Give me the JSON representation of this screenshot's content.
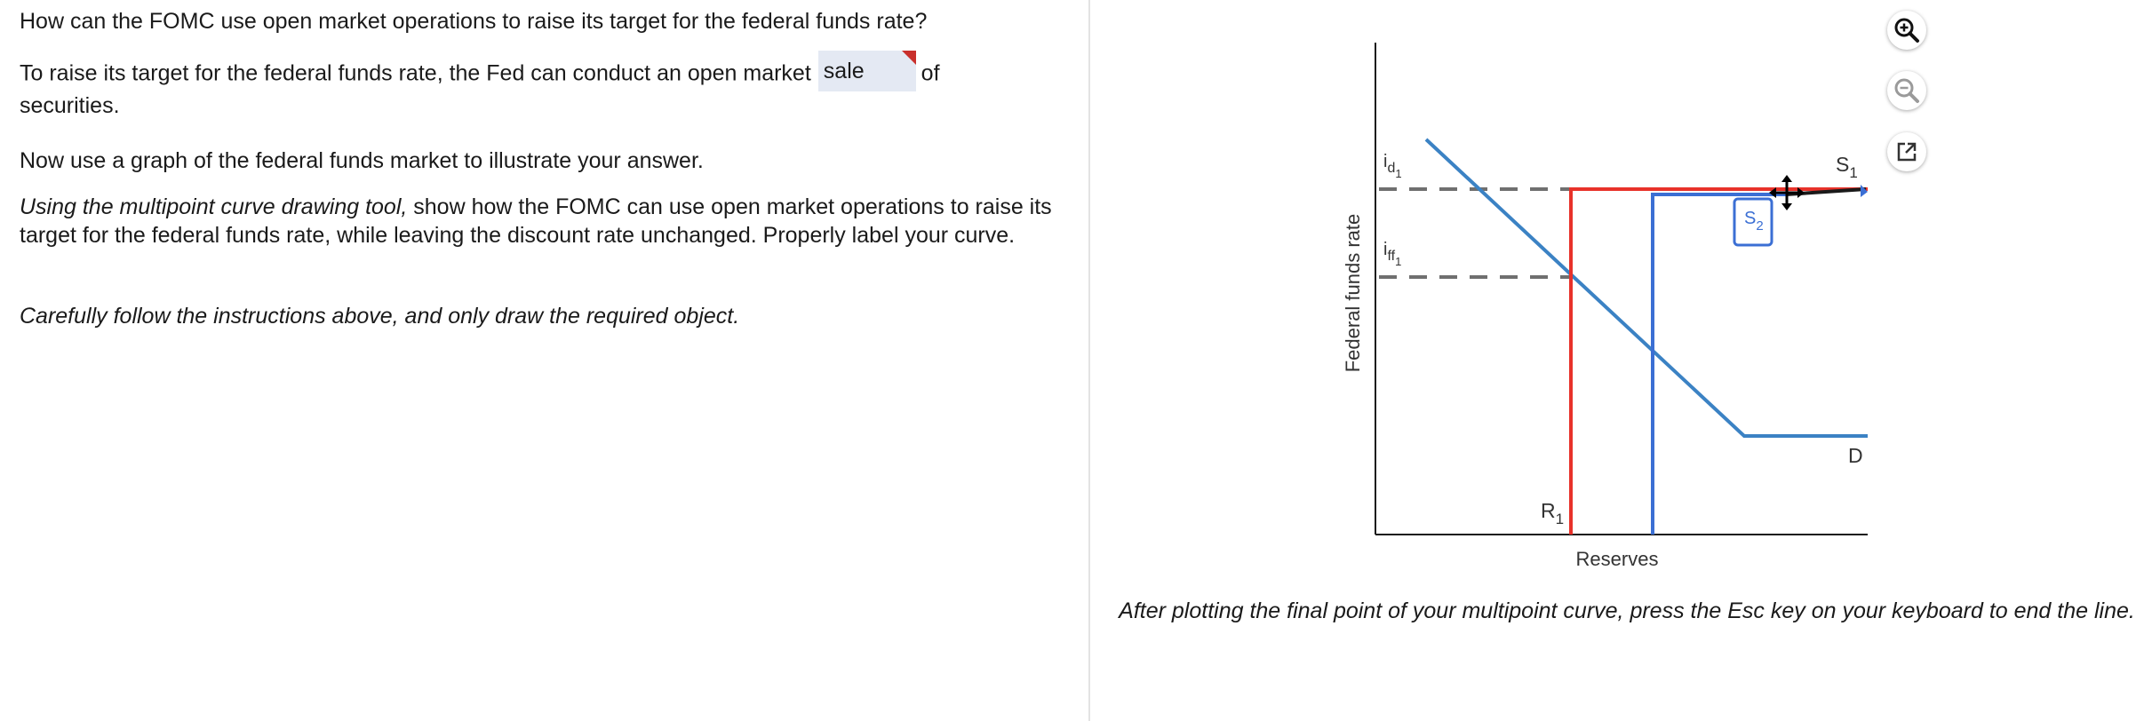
{
  "question": {
    "prompt": "How can the FOMC use open market operations to raise its target for the federal funds rate?",
    "answer_before": "To raise its target for the federal funds rate, the Fed can conduct an open market",
    "answer_selected": "sale",
    "answer_after": "of",
    "answer_wrap": "securities.",
    "graph_instruction": "Now use a graph of the federal funds market to illustrate your answer.",
    "tool_instruction_italic": "Using the multipoint curve drawing tool,",
    "tool_instruction_rest": " show how the FOMC can use open market operations to raise its target for the federal funds rate, while leaving the discount rate unchanged. Properly label your curve.",
    "caution": "Carefully follow the instructions above, and only draw the required object."
  },
  "graph": {
    "y_axis_label": "Federal funds rate",
    "x_axis_label": "Reserves",
    "label_id_main": "i",
    "label_id_sub": "d",
    "label_id_subsub": "1",
    "label_iff_main": "i",
    "label_iff_sub": "ff",
    "label_iff_subsub": "1",
    "label_R_main": "R",
    "label_R_sub": "1",
    "label_S1_main": "S",
    "label_S1_sub": "1",
    "label_S2_main": "S",
    "label_S2_sub": "2",
    "label_D": "D",
    "colors": {
      "original_supply": "#e8322a",
      "new_supply": "#3b6fd4",
      "demand": "#3b82c4",
      "dashed": "#6f6f6f",
      "axis": "#1a1a1a"
    }
  },
  "tools": {
    "zoom_in": "zoom-in-icon",
    "zoom_out": "zoom-out-icon",
    "popout": "external-link-icon"
  },
  "footer_instruction": "After plotting the final point of your multipoint curve, press the Esc key on your keyboard to end the line."
}
